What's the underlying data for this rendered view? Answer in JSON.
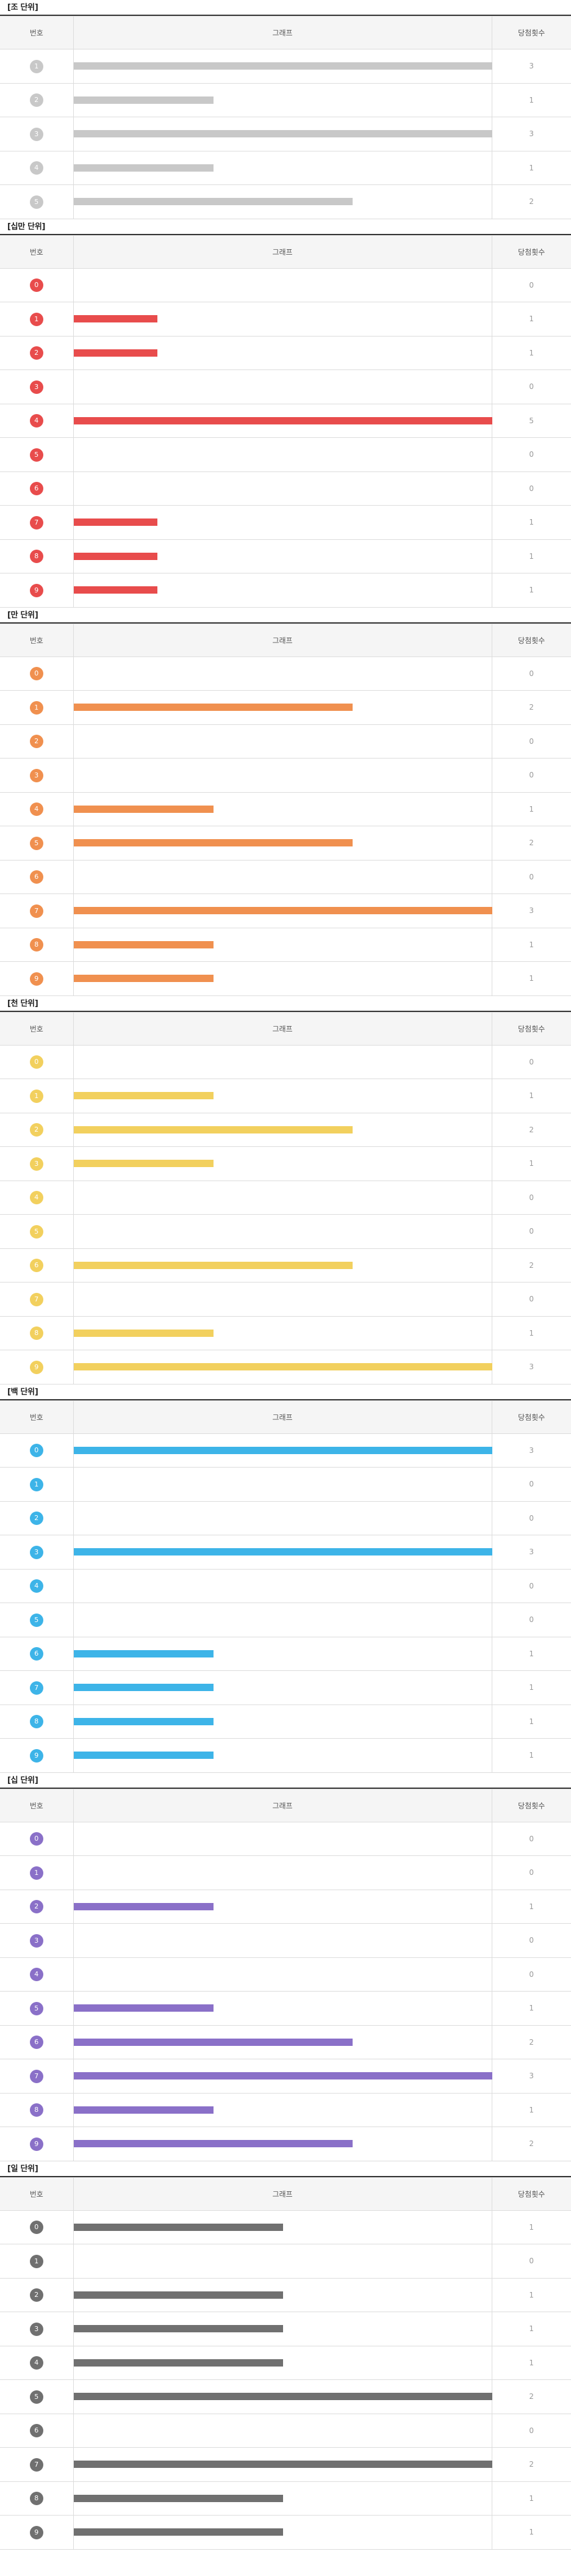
{
  "header_labels": {
    "number": "번호",
    "graph": "그래프",
    "count": "당첨횟수"
  },
  "chart_data": [
    {
      "type": "bar",
      "title": "[조 단위]",
      "color": "#c8c8c8",
      "ball_color": "#c8c8c8",
      "max": 3,
      "categories": [
        "1",
        "2",
        "3",
        "4",
        "5"
      ],
      "values": [
        3,
        1,
        3,
        1,
        2
      ]
    },
    {
      "type": "bar",
      "title": "[십만 단위]",
      "color": "#e84c4c",
      "ball_color": "#e84c4c",
      "max": 5,
      "categories": [
        "0",
        "1",
        "2",
        "3",
        "4",
        "5",
        "6",
        "7",
        "8",
        "9"
      ],
      "values": [
        0,
        1,
        1,
        0,
        5,
        0,
        0,
        1,
        1,
        1
      ]
    },
    {
      "type": "bar",
      "title": "[만 단위]",
      "color": "#f0904f",
      "ball_color": "#f0904f",
      "max": 3,
      "categories": [
        "0",
        "1",
        "2",
        "3",
        "4",
        "5",
        "6",
        "7",
        "8",
        "9"
      ],
      "values": [
        0,
        2,
        0,
        0,
        1,
        2,
        0,
        3,
        1,
        1
      ]
    },
    {
      "type": "bar",
      "title": "[천 단위]",
      "color": "#f2d05e",
      "ball_color": "#f2d05e",
      "max": 3,
      "categories": [
        "0",
        "1",
        "2",
        "3",
        "4",
        "5",
        "6",
        "7",
        "8",
        "9"
      ],
      "values": [
        0,
        1,
        2,
        1,
        0,
        0,
        2,
        0,
        1,
        3
      ]
    },
    {
      "type": "bar",
      "title": "[백 단위]",
      "color": "#3db4e8",
      "ball_color": "#3db4e8",
      "max": 3,
      "categories": [
        "0",
        "1",
        "2",
        "3",
        "4",
        "5",
        "6",
        "7",
        "8",
        "9"
      ],
      "values": [
        3,
        0,
        0,
        3,
        0,
        0,
        1,
        1,
        1,
        1
      ]
    },
    {
      "type": "bar",
      "title": "[십 단위]",
      "color": "#8a70c8",
      "ball_color": "#8a70c8",
      "max": 3,
      "categories": [
        "0",
        "1",
        "2",
        "3",
        "4",
        "5",
        "6",
        "7",
        "8",
        "9"
      ],
      "values": [
        0,
        0,
        1,
        0,
        0,
        1,
        2,
        3,
        1,
        2
      ]
    },
    {
      "type": "bar",
      "title": "[일 단위]",
      "color": "#707070",
      "ball_color": "#707070",
      "max": 2,
      "categories": [
        "0",
        "1",
        "2",
        "3",
        "4",
        "5",
        "6",
        "7",
        "8",
        "9"
      ],
      "values": [
        1,
        0,
        1,
        1,
        1,
        2,
        0,
        2,
        1,
        1
      ]
    }
  ]
}
